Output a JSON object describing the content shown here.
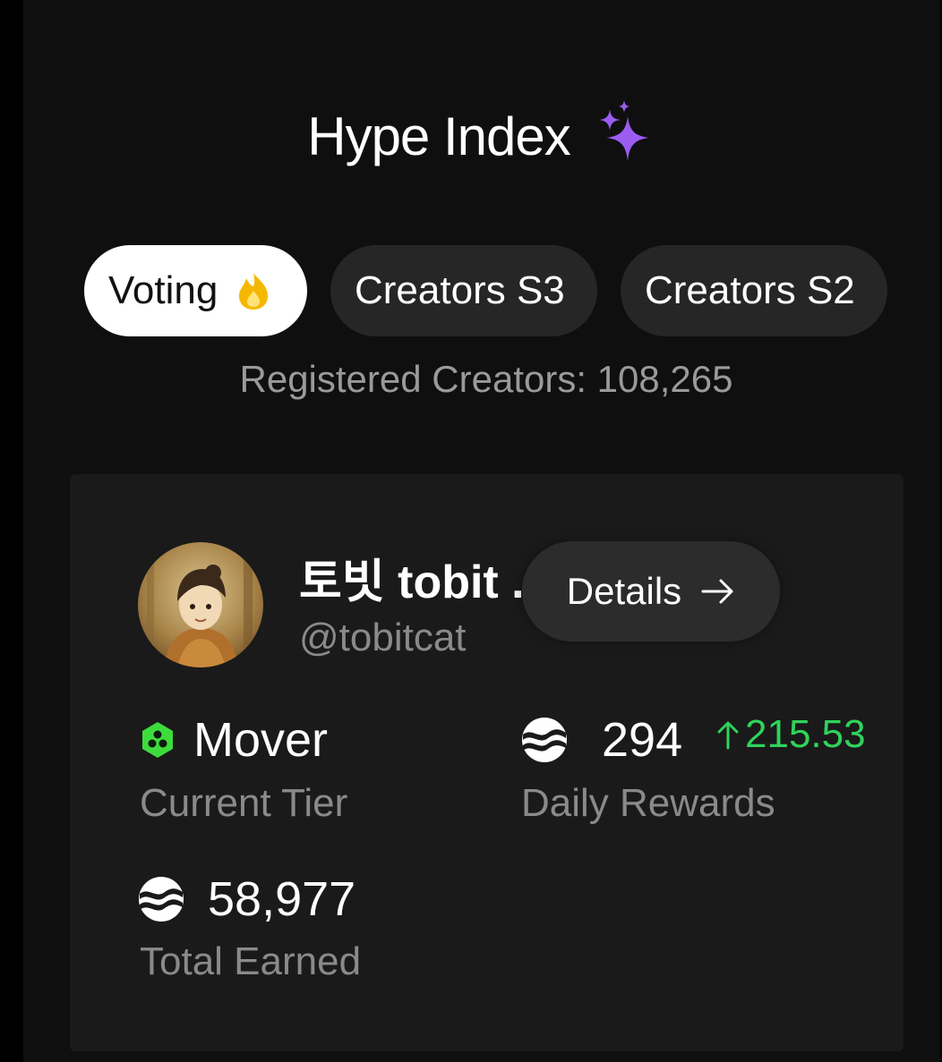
{
  "header": {
    "title": "Hype Index",
    "title_icon": "sparkles-icon"
  },
  "tabs": [
    {
      "label": "Voting",
      "icon": "flame-icon",
      "active": true
    },
    {
      "label": "Creators S3",
      "active": false
    },
    {
      "label": "Creators S2",
      "active": false
    }
  ],
  "registered_text": "Registered Creators: 108,265",
  "creator": {
    "name": "토빗 tobit ...",
    "handle": "@tobitcat",
    "avatar": "avatar-image",
    "details_label": "Details"
  },
  "stats": {
    "tier": {
      "value": "Mover",
      "label": "Current Tier",
      "icon": "hexagon-tier-icon",
      "color": "#3ddc3d"
    },
    "daily": {
      "value": "294",
      "change": "215.53",
      "label": "Daily Rewards",
      "icon": "wave-coin-icon",
      "change_color": "#2fd35a"
    },
    "total": {
      "value": "58,977",
      "label": "Total Earned",
      "icon": "wave-coin-icon"
    }
  },
  "colors": {
    "background": "#0f0f0f",
    "card": "#1a1a1a",
    "accent_purple": "#9b5cf0",
    "flame": "#f5b800"
  }
}
